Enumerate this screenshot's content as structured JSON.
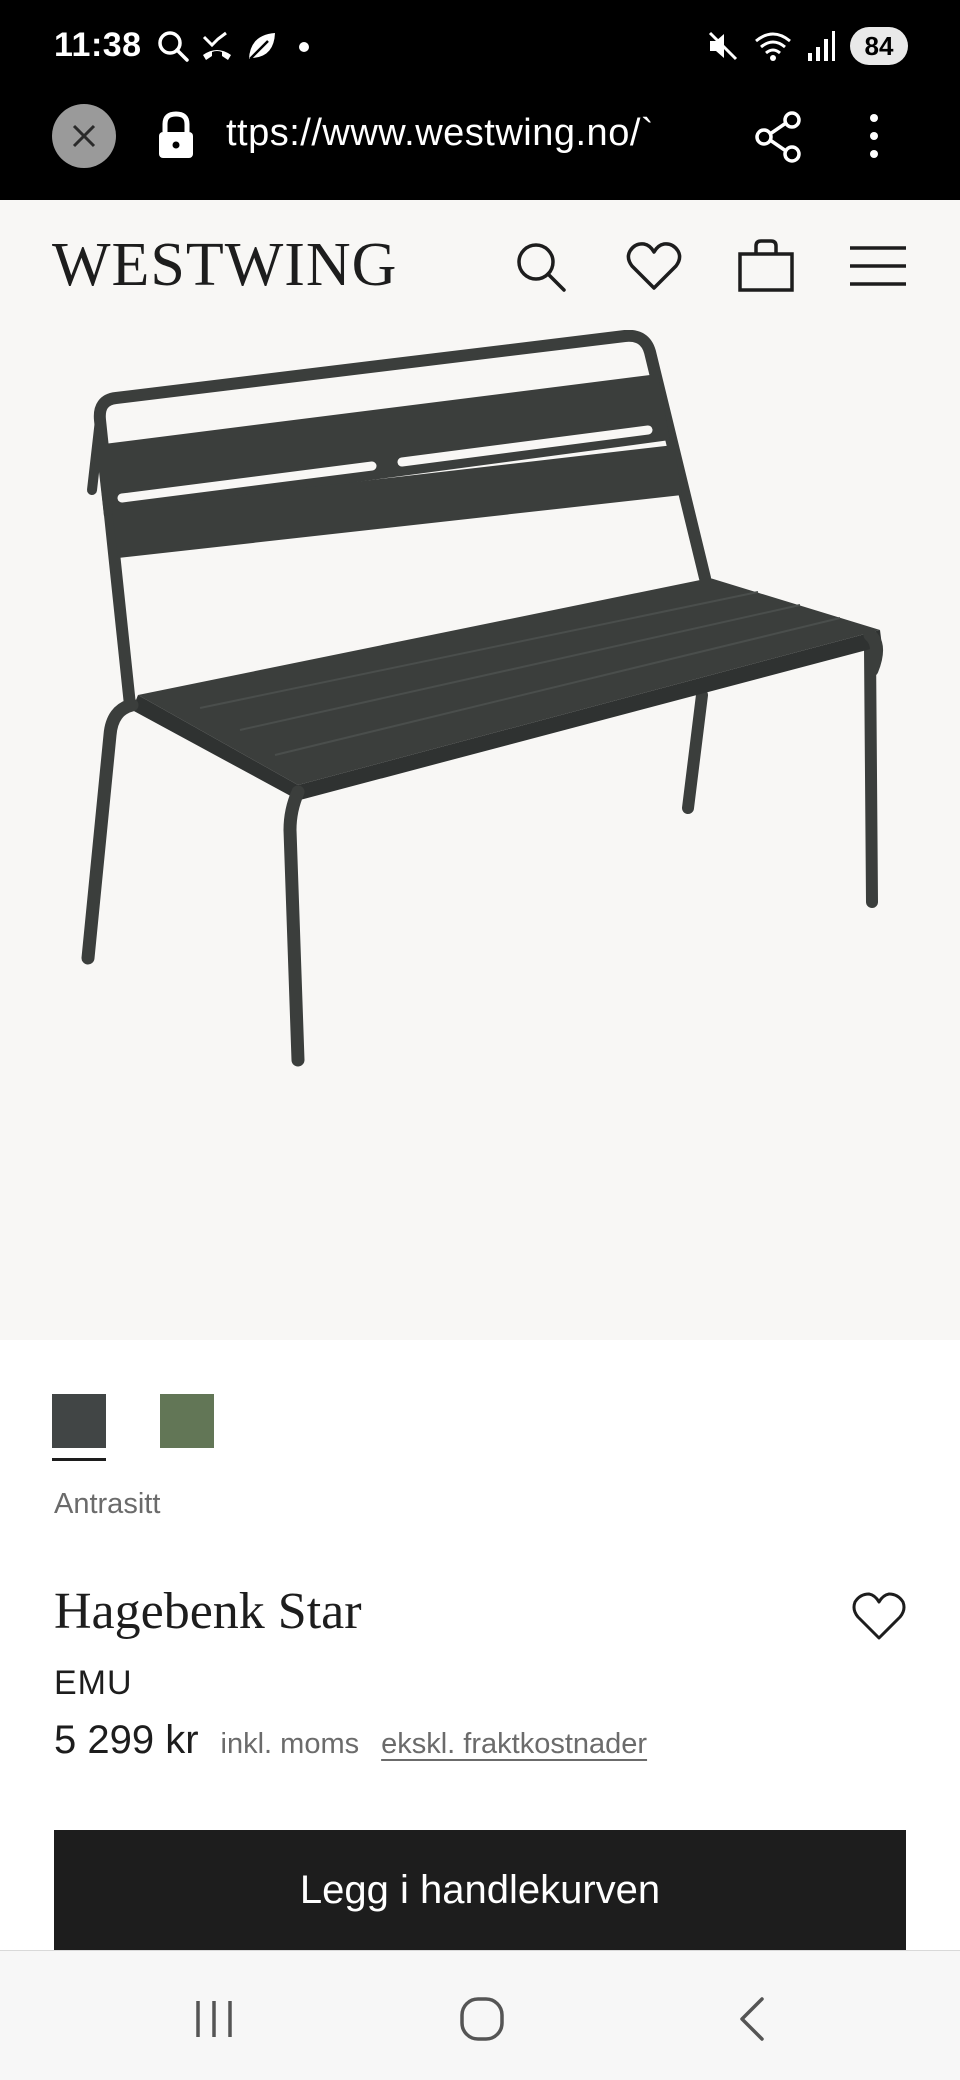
{
  "status_bar": {
    "time": "11:38",
    "battery": "84",
    "icons": [
      "search-icon",
      "missed-call-icon",
      "leaf-icon",
      "dot-icon",
      "mute-icon",
      "wifi-icon",
      "signal-icon"
    ]
  },
  "browser": {
    "url": "ttps://www.westwing.no/`",
    "icons": [
      "close-icon",
      "lock-icon",
      "share-icon",
      "more-vert-icon"
    ]
  },
  "header": {
    "logo": "WESTWING",
    "icons": [
      "search-icon",
      "heart-icon",
      "bag-icon",
      "menu-icon"
    ]
  },
  "product": {
    "image_alt": "bench",
    "swatches": [
      {
        "color": "#414545",
        "selected": true
      },
      {
        "color": "#627656",
        "selected": false
      }
    ],
    "color_name": "Antrasitt",
    "title": "Hagebenk Star",
    "brand": "EMU",
    "price": "5 299 kr",
    "tax_info": "inkl. moms",
    "shipping_link": "ekskl. fraktkostnader",
    "add_to_cart": "Legg i handlekurven"
  },
  "nav_bar": {
    "icons": [
      "recent-apps-icon",
      "home-icon",
      "back-icon"
    ]
  },
  "colors": {
    "header_bg": "#f8f7f5",
    "button_bg": "#1d1d1d",
    "bench": "#3b3e3c"
  }
}
